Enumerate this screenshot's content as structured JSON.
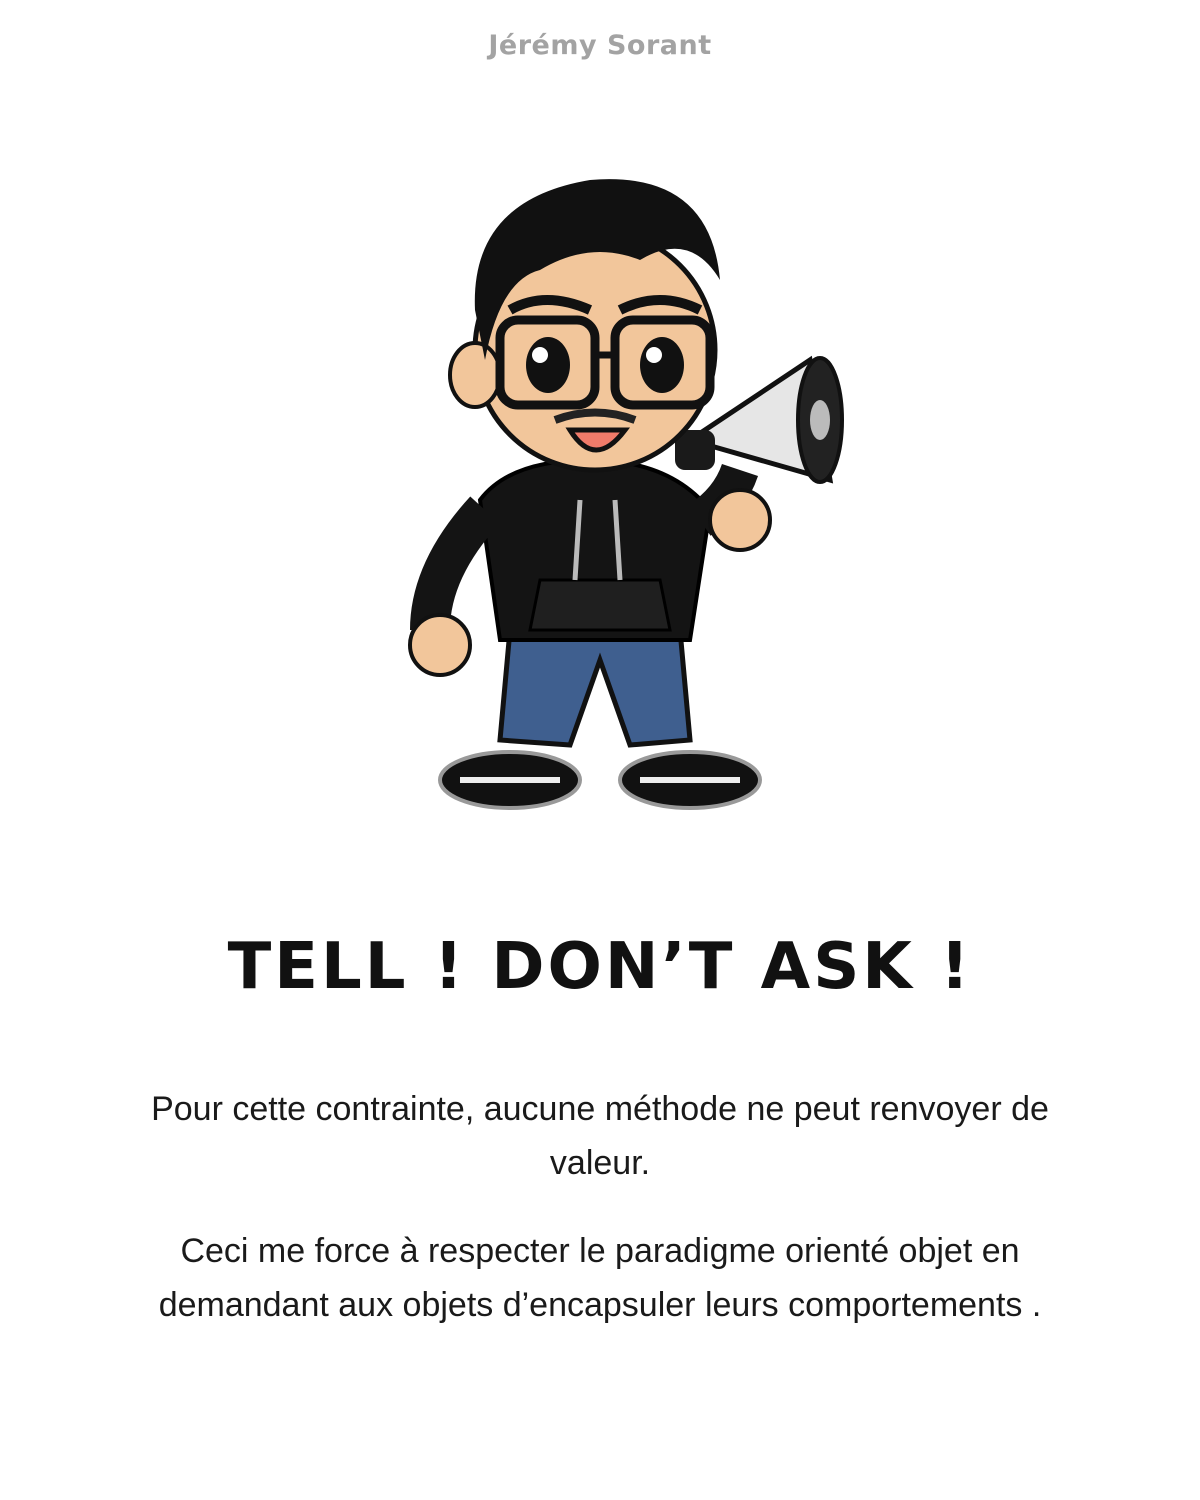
{
  "author": "Jérémy Sorant",
  "illustration": {
    "icon": "cartoon-character-megaphone-icon",
    "colors": {
      "hair": "#111111",
      "skin": "#f2c69b",
      "hoodie": "#141414",
      "jeans": "#3f5f8f",
      "megaphone": "#e6e6e6",
      "mouth": "#f07b6a"
    }
  },
  "title": "TELL ! DON’T ASK !",
  "paragraphs": [
    "Pour cette contrainte, aucune méthode ne peut renvoyer de valeur.",
    "Ceci me force à respecter le paradigme orienté objet en demandant aux objets d’encapsuler leurs comportements ."
  ]
}
